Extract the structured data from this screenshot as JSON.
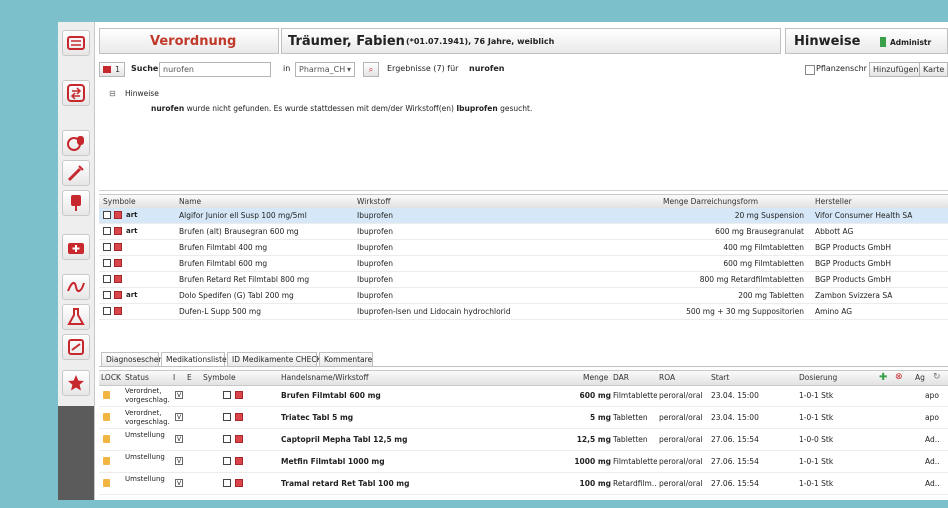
{
  "header": {
    "title": "Verordnung",
    "patient": "Träumer, Fabien",
    "patient_info": "(*01.07.1941), 76 Jahre, weiblich",
    "hints_title": "Hinweise",
    "admin_label": "Administr"
  },
  "search": {
    "count": "1",
    "label": "Suche",
    "value": "nurofen",
    "in_label": "in",
    "source": "Pharma_CH",
    "result_text": "Ergebnisse (7) für",
    "query": "nurofen",
    "checkbox_label": "Pflanzenschr",
    "add_button": "Hinzufügen",
    "cancel_button": "Karte"
  },
  "hints": {
    "title": "Hinweise",
    "message_bold": "nurofen",
    "message_text": "wurde nicht gefunden. Es wurde stattdessen mit dem/der Wirkstoff(en)",
    "message_substance": "Ibuprofen",
    "message_end": "gesucht."
  },
  "results": {
    "columns": [
      "Symbole",
      "Name",
      "Wirkstoff",
      "Menge  Darreichungsform",
      "Hersteller"
    ],
    "rows": [
      {
        "name": "Algifor Junior ell Susp 100 mg/5ml",
        "substance": "Ibuprofen",
        "amount": "20 mg Suspension",
        "maker": "Vifor Consumer Health SA",
        "tag": "art"
      },
      {
        "name": "Brufen (alt) Brausegran 600 mg",
        "substance": "Ibuprofen",
        "amount": "600 mg Brausegranulat",
        "maker": "Abbott AG",
        "tag": "art"
      },
      {
        "name": "Brufen Filmtabl 400 mg",
        "substance": "Ibuprofen",
        "amount": "400 mg Filmtabletten",
        "maker": "BGP Products GmbH",
        "tag": ""
      },
      {
        "name": "Brufen Filmtabl 600 mg",
        "substance": "Ibuprofen",
        "amount": "600 mg Filmtabletten",
        "maker": "BGP Products GmbH",
        "tag": ""
      },
      {
        "name": "Brufen Retard Ret Filmtabl 800 mg",
        "substance": "Ibuprofen",
        "amount": "800 mg Retardfilmtabletten",
        "maker": "BGP Products GmbH",
        "tag": ""
      },
      {
        "name": "Dolo Spedifen (G) Tabl 200 mg",
        "substance": "Ibuprofen",
        "amount": "200 mg Tabletten",
        "maker": "Zambon Svizzera SA",
        "tag": "art"
      },
      {
        "name": "Dufen-L Supp 500 mg",
        "substance": "Ibuprofen-lsen und Lidocain hydrochlorid",
        "amount": "500 mg + 30 mg Suppositorien",
        "maker": "Amino AG",
        "tag": ""
      }
    ]
  },
  "tabs": [
    "Diagnoseschema",
    "Medikationsliste",
    "ID Medikamente CHECK",
    "Kommentare"
  ],
  "meds": {
    "columns": [
      "LOCK",
      "Status",
      "I",
      "E",
      "Symbole",
      "Handelsname/Wirkstoff",
      "Menge",
      "DAR",
      "ROA",
      "Start",
      "Dosierung",
      "Ag"
    ],
    "rows": [
      {
        "status": "Verordnet, vorgeschlag.",
        "name": "Brufen Filmtabl 600 mg",
        "qty": "600 mg",
        "dar": "Filmtabletten",
        "roa": "peroral/oral",
        "start": "23.04. 15:00",
        "dose": "1-0-1 Stk",
        "ag": "apo"
      },
      {
        "status": "Verordnet, vorgeschlag.",
        "name": "Triatec Tabl 5 mg",
        "qty": "5 mg",
        "dar": "Tabletten",
        "roa": "peroral/oral",
        "start": "23.04. 15:00",
        "dose": "1-0-1 Stk",
        "ag": "apo"
      },
      {
        "status": "Umstellung",
        "name": "Captopril Mepha Tabl 12,5 mg",
        "qty": "12,5 mg",
        "dar": "Tabletten",
        "roa": "peroral/oral",
        "start": "27.06. 15:54",
        "dose": "1-0-0 Stk",
        "ag": "Ad.."
      },
      {
        "status": "Umstellung",
        "name": "Metfin Filmtabl 1000 mg",
        "qty": "1000 mg",
        "dar": "Filmtabletten",
        "roa": "peroral/oral",
        "start": "27.06. 15:54",
        "dose": "1-0-1 Stk",
        "ag": "Ad.."
      },
      {
        "status": "Umstellung",
        "name": "Tramal retard Ret Tabl 100 mg",
        "qty": "100 mg",
        "dar": "Retardfilm..",
        "roa": "peroral/oral",
        "start": "27.06. 15:54",
        "dose": "1-0-1 Stk",
        "ag": "Ad.."
      }
    ]
  },
  "colors": {
    "title_red": "#c0392b",
    "accent_teal": "#7cc0cb",
    "selected_row": "#d6e8f7"
  }
}
